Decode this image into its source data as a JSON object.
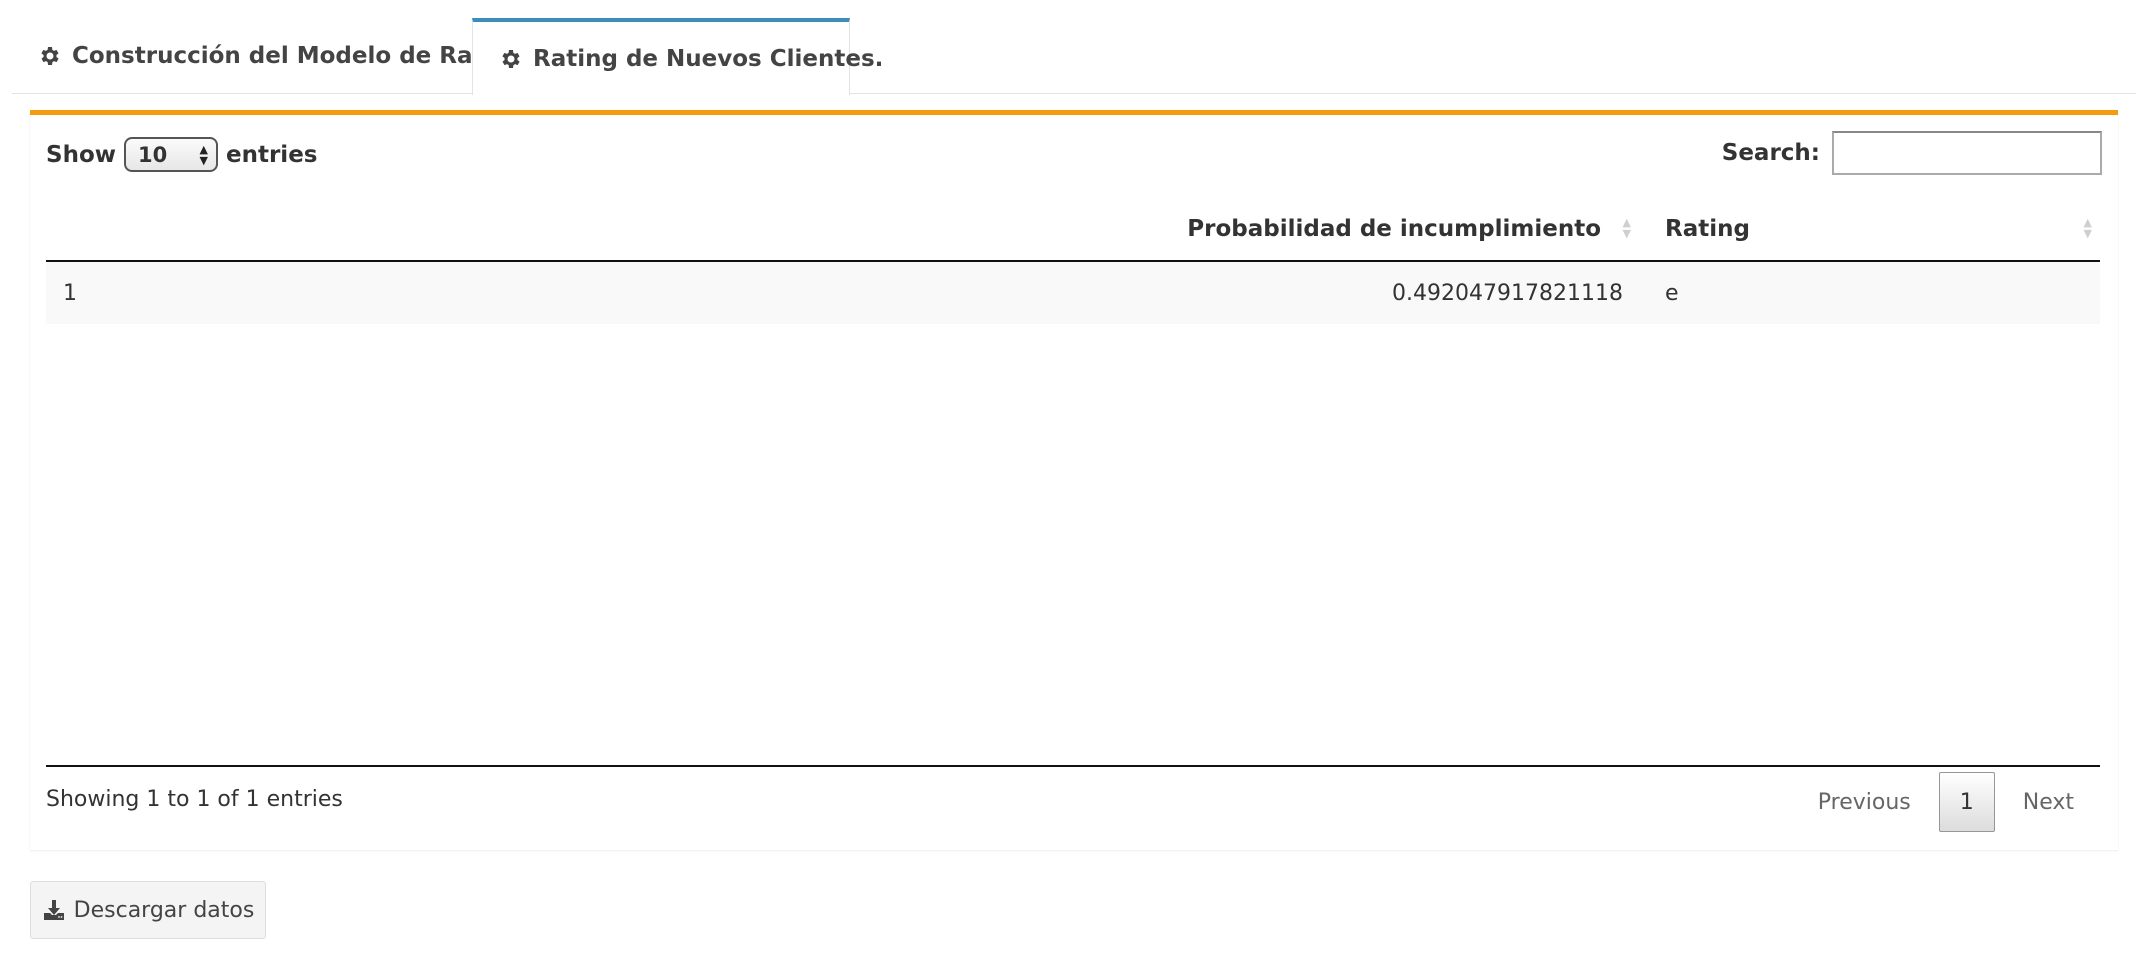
{
  "tabs": [
    {
      "label": "Construcción del Modelo de Rating",
      "icon": "gear-icon",
      "active": false
    },
    {
      "label": "Rating de Nuevos Clientes.",
      "icon": "gear-icon",
      "active": true
    }
  ],
  "colors": {
    "active_tab_border": "#3c8dbc",
    "box_border": "#f39c12"
  },
  "table_controls": {
    "show_label": "Show",
    "page_length": "10",
    "entries_label": "entries",
    "search_label": "Search:",
    "search_value": ""
  },
  "table": {
    "columns": [
      "",
      "Probabilidad de incumplimiento",
      "Rating"
    ],
    "rows": [
      {
        "index": "1",
        "probabilidad": "0.492047917821118",
        "rating": "e"
      }
    ]
  },
  "footer": {
    "info": "Showing 1 to 1 of 1 entries",
    "previous": "Previous",
    "current_page": "1",
    "next": "Next"
  },
  "download": {
    "label": "Descargar datos",
    "icon": "download-icon"
  }
}
